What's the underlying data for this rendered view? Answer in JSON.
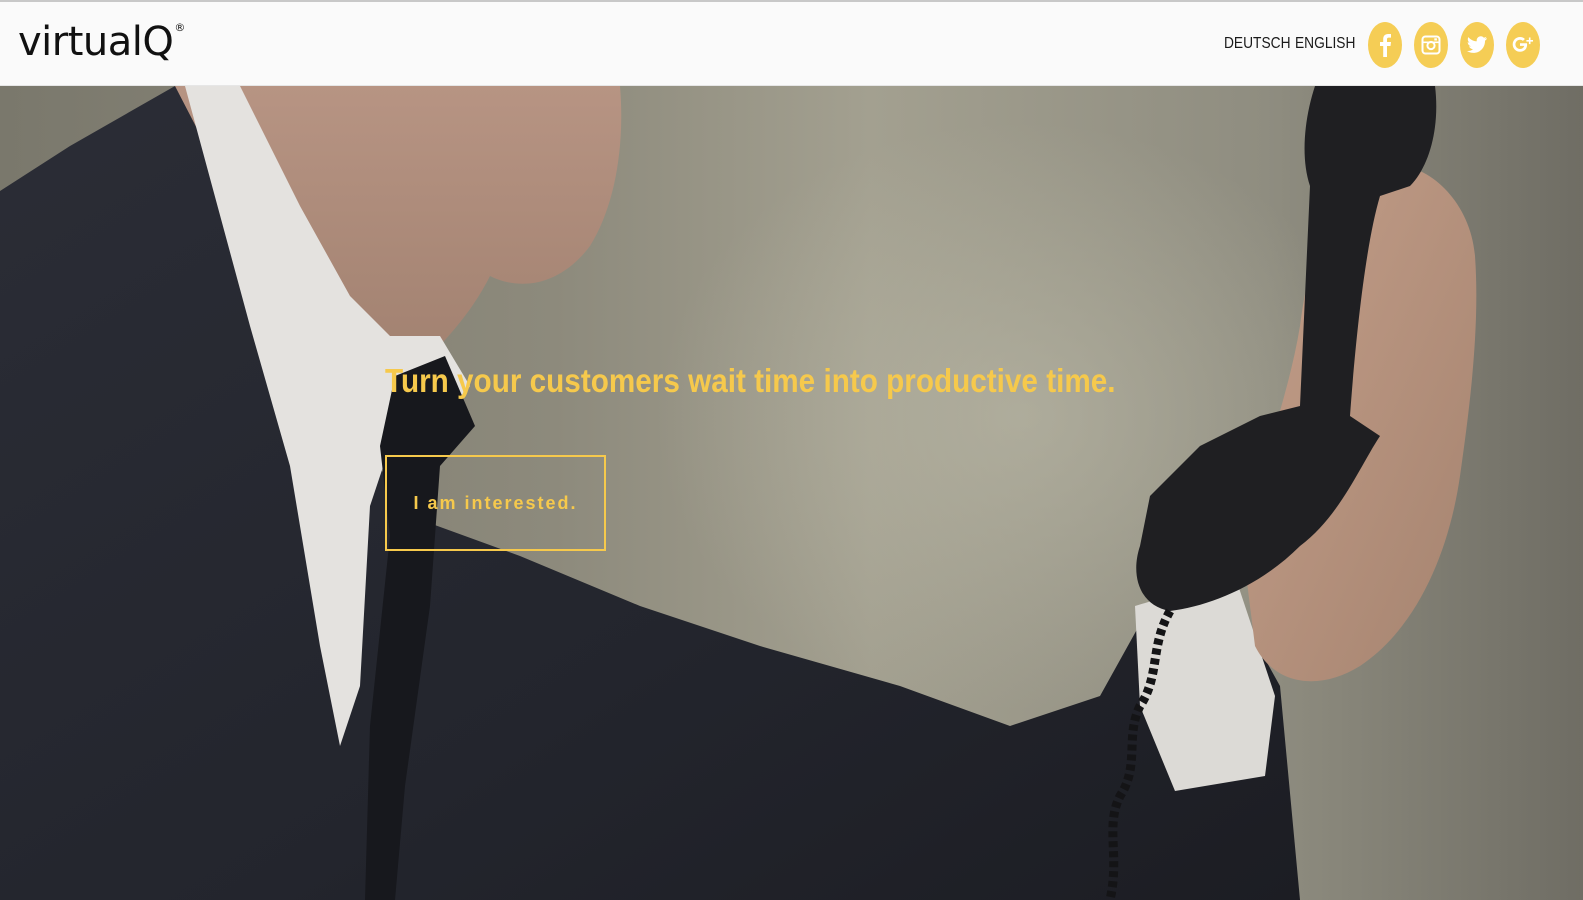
{
  "header": {
    "logo_text": "virtualQ",
    "logo_mark": "®",
    "languages": [
      "DEUTSCH",
      "ENGLISH"
    ],
    "social": [
      "facebook-icon",
      "instagram-icon",
      "twitter-icon",
      "google-plus-icon"
    ]
  },
  "hero": {
    "headline": "Turn your customers wait time into productive time.",
    "cta_label": "I am interested."
  },
  "colors": {
    "accent": "#f6c94c",
    "header_bg": "#fafafa",
    "logo": "#111111"
  }
}
